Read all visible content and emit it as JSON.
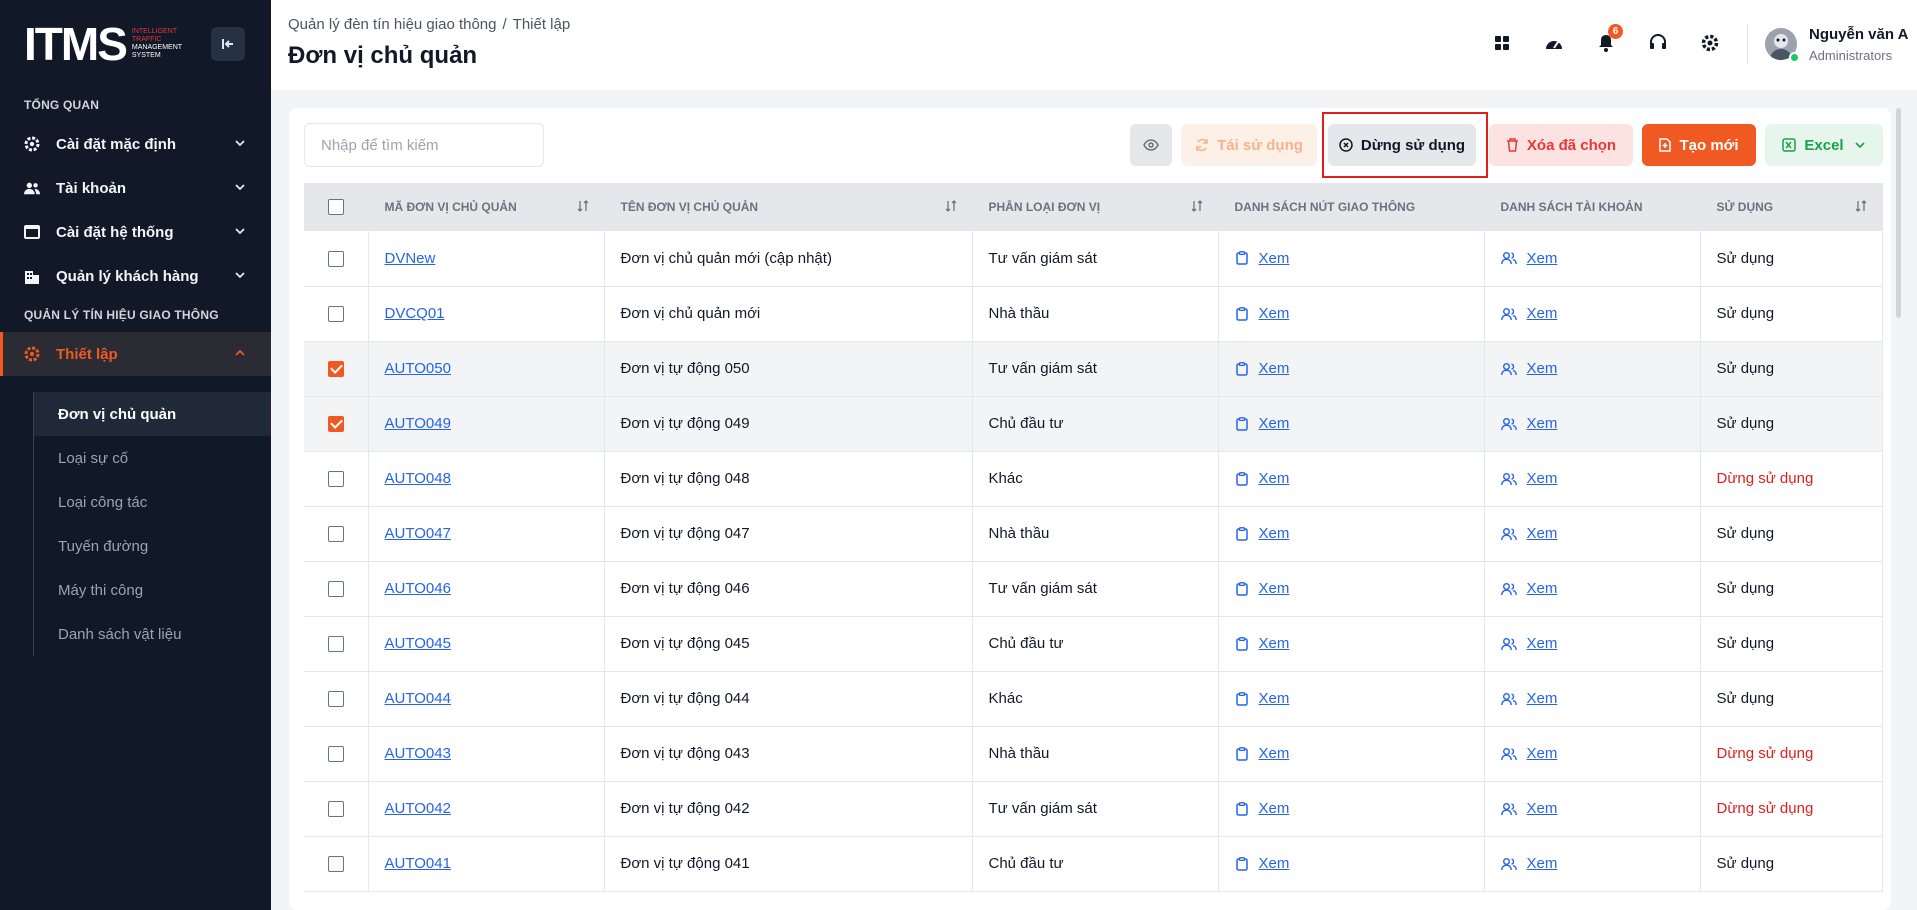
{
  "sidebar": {
    "logo": {
      "mark": "ITMS",
      "line1": "INTELLIGENT",
      "line2": "TRAFFIC",
      "line3": "MANAGEMENT",
      "line4": "SYSTEM"
    },
    "section_overview": "TỔNG QUAN",
    "items": [
      {
        "label": "Cài đặt mặc định",
        "icon": "gear-icon"
      },
      {
        "label": "Tài khoản",
        "icon": "users-icon"
      },
      {
        "label": "Cài đặt hệ thống",
        "icon": "window-icon"
      },
      {
        "label": "Quản lý khách hàng",
        "icon": "building-icon"
      }
    ],
    "section_traffic": "QUẢN LÝ TÍN HIỆU GIAO THÔNG",
    "active_item": {
      "label": "Thiết lập",
      "icon": "gear-icon"
    },
    "sub_items": [
      {
        "label": "Đơn vị chủ quản"
      },
      {
        "label": "Loại sự cố"
      },
      {
        "label": "Loại công tác"
      },
      {
        "label": "Tuyến đường"
      },
      {
        "label": "Máy thi công"
      },
      {
        "label": "Danh sách vật liệu"
      }
    ]
  },
  "header": {
    "breadcrumb": [
      "Quản lý đèn tín hiệu giao thông",
      "Thiết lập"
    ],
    "breadcrumb_sep": "/",
    "title": "Đơn vị chủ quản",
    "notification_count": "6",
    "user": {
      "name": "Nguyễn văn A",
      "role": "Administrators"
    }
  },
  "toolbar": {
    "search_placeholder": "Nhập để tìm kiếm",
    "reuse_label": "Tái sử dụng",
    "stop_label": "Dừng sử dụng",
    "delete_label": "Xóa đã chọn",
    "new_label": "Tạo mới",
    "excel_label": "Excel"
  },
  "table": {
    "headers": [
      "MÃ ĐƠN VỊ CHỦ QUẢN",
      "TÊN ĐƠN VỊ CHỦ QUẢN",
      "PHÂN LOẠI ĐƠN VỊ",
      "DANH SÁCH NÚT GIAO THÔNG",
      "DANH SÁCH TÀI KHOẢN",
      "SỬ DỤNG"
    ],
    "view_label": "Xem",
    "rows": [
      {
        "code": "DVNew",
        "name": "Đơn vị chủ quản mới (cập nhật)",
        "type": "Tư vấn giám sát",
        "status": "Sử dụng",
        "checked": false
      },
      {
        "code": "DVCQ01",
        "name": "Đơn vị chủ quản mới",
        "type": "Nhà thầu",
        "status": "Sử dụng",
        "checked": false
      },
      {
        "code": "AUTO050",
        "name": "Đơn vị tự động 050",
        "type": "Tư vấn giám sát",
        "status": "Sử dụng",
        "checked": true
      },
      {
        "code": "AUTO049",
        "name": "Đơn vị tự động 049",
        "type": "Chủ đầu tư",
        "status": "Sử dụng",
        "checked": true
      },
      {
        "code": "AUTO048",
        "name": "Đơn vị tự động 048",
        "type": "Khác",
        "status": "Dừng sử dụng",
        "checked": false
      },
      {
        "code": "AUTO047",
        "name": "Đơn vị tự động 047",
        "type": "Nhà thầu",
        "status": "Sử dụng",
        "checked": false
      },
      {
        "code": "AUTO046",
        "name": "Đơn vị tự động 046",
        "type": "Tư vấn giám sát",
        "status": "Sử dụng",
        "checked": false
      },
      {
        "code": "AUTO045",
        "name": "Đơn vị tự động 045",
        "type": "Chủ đầu tư",
        "status": "Sử dụng",
        "checked": false
      },
      {
        "code": "AUTO044",
        "name": "Đơn vị tự động 044",
        "type": "Khác",
        "status": "Sử dụng",
        "checked": false
      },
      {
        "code": "AUTO043",
        "name": "Đơn vị tự động 043",
        "type": "Nhà thầu",
        "status": "Dừng sử dụng",
        "checked": false
      },
      {
        "code": "AUTO042",
        "name": "Đơn vị tự động 042",
        "type": "Tư vấn giám sát",
        "status": "Dừng sử dụng",
        "checked": false
      },
      {
        "code": "AUTO041",
        "name": "Đơn vị tự động 041",
        "type": "Chủ đầu tư",
        "status": "Sử dụng",
        "checked": false
      }
    ]
  },
  "colors": {
    "accent": "#f05a22",
    "sidebar_bg": "#111827",
    "stopped": "#e11d1d",
    "link": "#2563eb"
  }
}
